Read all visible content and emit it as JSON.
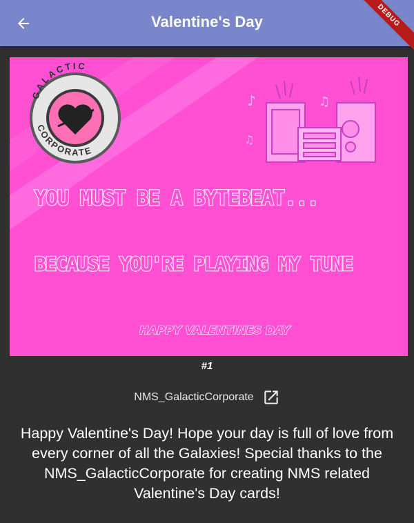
{
  "appbar": {
    "title": "Valentine's Day",
    "back_icon": "arrow-left-icon",
    "menu_icon": "more-vert-icon",
    "debug_label": "DEBUG"
  },
  "card": {
    "logo_top_text": "GALACTIC",
    "logo_bottom_text": "CORPORATE",
    "line1": "YOU MUST BE A BYTEBEAT...",
    "line2": "BECAUSE YOU'RE PLAYING MY TUNE",
    "line3": "HAPPY VALENTINES DAY",
    "background_color": "#ff4fd3"
  },
  "caption": "#1",
  "author": {
    "name": "NMS_GalacticCorporate",
    "link_icon": "open-in-new-icon"
  },
  "description": "Happy Valentine's Day! Hope your day is full of love from every corner of all the Galaxies! Special thanks to the NMS_GalacticCorporate for creating NMS related Valentine's Day cards!"
}
